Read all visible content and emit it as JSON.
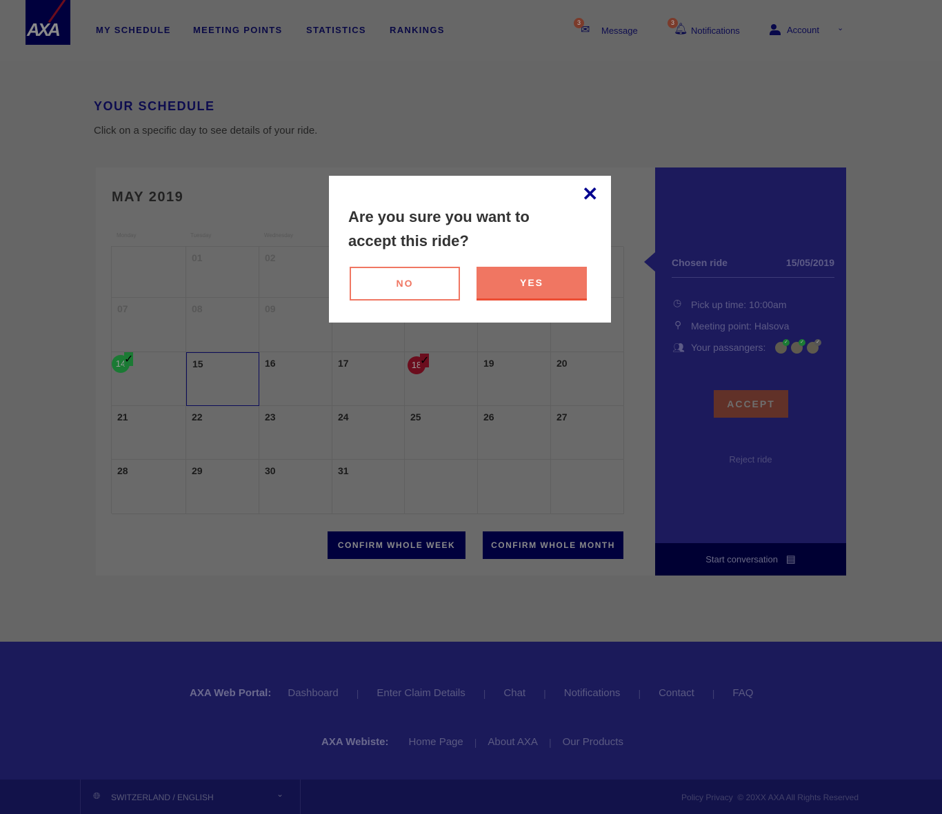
{
  "header": {
    "logo": "AXA",
    "nav": [
      "MY SCHEDULE",
      "MEETING POINTS",
      "STATISTICS",
      "RANKINGS"
    ],
    "message": {
      "label": "Message",
      "count": "3"
    },
    "notifications": {
      "label": "Notifications",
      "count": "3"
    },
    "account": {
      "label": "Account"
    }
  },
  "page": {
    "title": "YOUR SCHEDULE",
    "subtitle": "Click on a specific day to see details of your ride."
  },
  "calendar": {
    "month": "MAY 2019",
    "weekdays": [
      "Monday",
      "Tuesday",
      "Wednesday"
    ],
    "rows": [
      [
        "",
        "01",
        "02",
        "",
        "",
        "",
        ""
      ],
      [
        "07",
        "08",
        "09",
        "",
        "",
        "",
        ""
      ],
      [
        "14",
        "15",
        "16",
        "17",
        "18",
        "19",
        "20"
      ],
      [
        "21",
        "22",
        "23",
        "24",
        "25",
        "26",
        "27"
      ],
      [
        "28",
        "29",
        "30",
        "31",
        "",
        "",
        ""
      ]
    ],
    "confirm_week": "CONFIRM WHOLE WEEK",
    "confirm_month": "CONFIRM WHOLE MONTH"
  },
  "panel": {
    "label": "Chosen ride",
    "date": "15/05/2019",
    "pickup": "Pick up time: 10:00am",
    "meeting": "Meeting point: Halsova",
    "passengers": "Your passangers:",
    "accept": "ACCEPT",
    "reject": "Reject ride",
    "conversation": "Start conversation"
  },
  "modal": {
    "question": "Are you sure you want to accept this ride?",
    "no": "NO",
    "yes": "YES"
  },
  "footer": {
    "portal_label": "AXA Web Portal:",
    "portal_links": [
      "Dashboard",
      "Enter Claim Details",
      "Chat",
      "Notifications",
      "Contact",
      "FAQ"
    ],
    "website_label": "AXA Webiste:",
    "website_links": [
      "Home Page",
      "About AXA",
      "Our Products"
    ],
    "locale": "SWITZERLAND / ENGLISH",
    "legal": "Policy Privacy  © 20XX AXA All Rights Reserved"
  },
  "colors": {
    "brand": "#00008f",
    "accent": "#f07662",
    "confirmed": "#1b7a34",
    "declined": "#8b0f22"
  }
}
